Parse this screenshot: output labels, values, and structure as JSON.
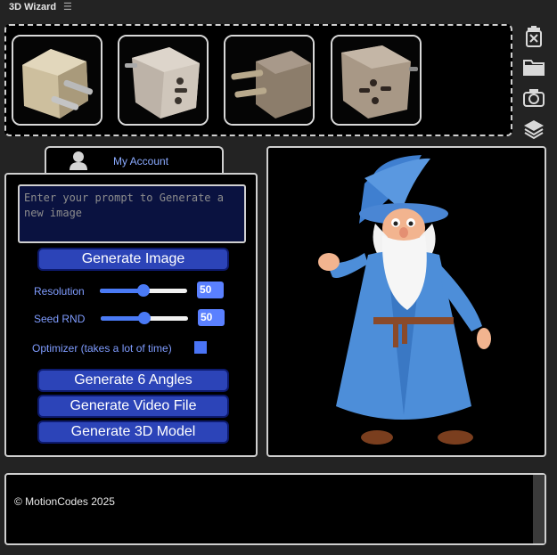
{
  "app": {
    "title": "3D Wizard",
    "menu_icon": "hamburger-icon"
  },
  "gallery": {
    "thumbnails": [
      {
        "name": "adapter-thumbnail-1"
      },
      {
        "name": "adapter-thumbnail-2"
      },
      {
        "name": "adapter-thumbnail-3"
      },
      {
        "name": "adapter-thumbnail-4"
      }
    ]
  },
  "toolbar": {
    "icons": [
      "trash-icon",
      "folder-icon",
      "camera-icon",
      "layers-icon"
    ]
  },
  "account": {
    "tab_label": "My Account",
    "icon": "user-icon"
  },
  "controls": {
    "prompt_placeholder": "Enter your prompt to Generate a new image",
    "generate_image_label": "Generate Image",
    "resolution_label": "Resolution",
    "resolution_value": "50",
    "resolution_fraction": 0.5,
    "seed_label": "Seed RND",
    "seed_value": "50",
    "seed_fraction": 0.5,
    "optimizer_label": "Optimizer (takes a lot of time)",
    "optimizer_checked": true,
    "generate_angles_label": "Generate 6 Angles",
    "generate_video_label": "Generate Video File",
    "generate_3d_label": "Generate 3D Model"
  },
  "preview": {
    "subject": "wizard-3d-character"
  },
  "footer": {
    "copyright": "© MotionCodes 2025"
  },
  "colors": {
    "accent": "#2c44b8",
    "label": "#7f9cff",
    "panel": "#000000",
    "background": "#232323"
  }
}
